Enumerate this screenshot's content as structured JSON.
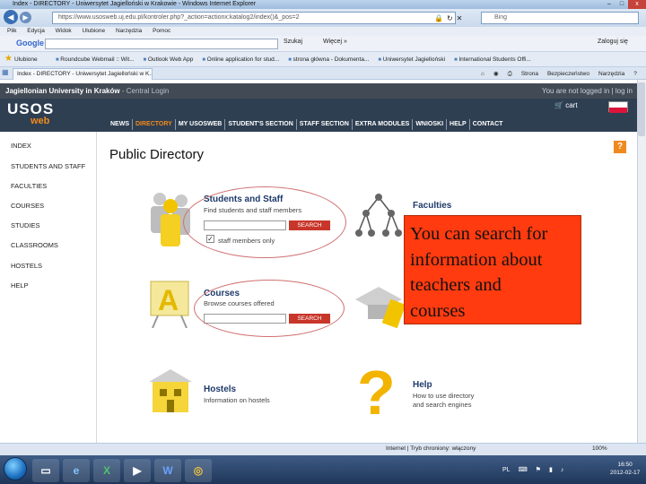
{
  "window": {
    "title": "Index - DIRECTORY - Uniwersytet Jagielloński w Krakowie - Windows Internet Explorer",
    "minimize": "–",
    "maximize": "□",
    "close": "x"
  },
  "address": {
    "url": "https://www.usosweb.uj.edu.pl/kontroler.php?_action=actionx:katalog2/index()&_pos=2",
    "search_placeholder": "Bing"
  },
  "menubar": [
    "Plik",
    "Edycja",
    "Widok",
    "Ulubione",
    "Narzędzia",
    "Pomoc"
  ],
  "googlebar": {
    "logo": "Google",
    "search_label": "Szukaj",
    "more_label": "Więcej »",
    "signin": "Zaloguj się"
  },
  "favorites": {
    "label": "Ulubione",
    "links": [
      "Roundcube Webmail :: Wit...",
      "Outlook Web App",
      "Online application for stud...",
      "strona główna - Dokumenta...",
      "Uniwersytet Jagielloński",
      "International Students Offi..."
    ]
  },
  "tab": {
    "title": "Index - DIRECTORY - Uniwersytet Jagielloński w K..."
  },
  "commandbar": [
    "Strona",
    "Bezpieczeństwo",
    "Narzędzia"
  ],
  "site": {
    "university": "Jagiellonian University in Kraków",
    "central_login": "- Central Login",
    "login_status": "You are not logged in | log in",
    "logo_top": "USOS",
    "logo_bottom": "web",
    "cart": "cart",
    "flag_colors": [
      "#ffffff",
      "#dc143c"
    ],
    "nav": [
      "NEWS",
      "DIRECTORY",
      "MY USOSWEB",
      "STUDENT'S SECTION",
      "STAFF SECTION",
      "EXTRA MODULES",
      "WNIOSKI",
      "HELP",
      "CONTACT"
    ]
  },
  "sidebar": {
    "items": [
      "INDEX",
      "STUDENTS AND STAFF",
      "FACULTIES",
      "COURSES",
      "STUDIES",
      "CLASSROOMS",
      "HOSTELS",
      "HELP"
    ]
  },
  "content": {
    "title": "Public Directory",
    "help_icon": "?",
    "tiles": {
      "students": {
        "title": "Students and Staff",
        "desc": "Find students and staff members",
        "button": "SEARCH",
        "checkbox_label": "staff members only"
      },
      "faculties": {
        "title": "Faculties"
      },
      "courses": {
        "title": "Courses",
        "desc": "Browse courses offered",
        "button": "SEARCH"
      },
      "hostels": {
        "title": "Hostels",
        "desc": "Information on hostels"
      },
      "help": {
        "title": "Help",
        "desc1": "How to use directory",
        "desc2": "and search engines"
      }
    }
  },
  "callout": {
    "lines": [
      "You can search for",
      "information about",
      "teachers and",
      "courses"
    ]
  },
  "statusbar": {
    "zone": "Internet | Tryb chroniony: włączony",
    "zoom": "100%"
  },
  "taskbar": {
    "lang": "PL",
    "time": "16:50",
    "date": "2012-02-17"
  }
}
